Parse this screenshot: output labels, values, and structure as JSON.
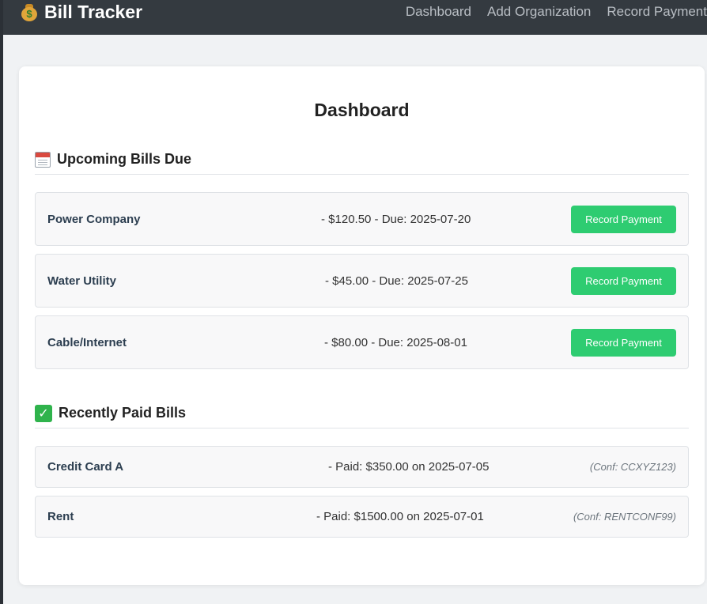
{
  "app": {
    "title": "Bill Tracker",
    "logo_icon": "money-bag-icon"
  },
  "nav": {
    "items": [
      "Dashboard",
      "Add Organization",
      "Record Payment"
    ]
  },
  "main": {
    "title": "Dashboard",
    "upcoming": {
      "heading": "Upcoming Bills Due",
      "icon": "calendar-icon",
      "bills": [
        {
          "name": "Power Company",
          "detail": "- $120.50 - Due: 2025-07-20",
          "button": "Record Payment"
        },
        {
          "name": "Water Utility",
          "detail": "- $45.00 - Due: 2025-07-25",
          "button": "Record Payment"
        },
        {
          "name": "Cable/Internet",
          "detail": "- $80.00 - Due: 2025-08-01",
          "button": "Record Payment"
        }
      ]
    },
    "paid": {
      "heading": "Recently Paid Bills",
      "icon": "check-mark-icon",
      "bills": [
        {
          "name": "Credit Card A",
          "detail": "- Paid: $350.00 on 2025-07-05",
          "conf": "(Conf: CCXYZ123)"
        },
        {
          "name": "Rent",
          "detail": "- Paid: $1500.00 on 2025-07-01",
          "conf": "(Conf: RENTCONF99)"
        }
      ]
    }
  },
  "colors": {
    "navbar": "#343a40",
    "button": "#2ecc71",
    "background": "#f0f2f4"
  }
}
